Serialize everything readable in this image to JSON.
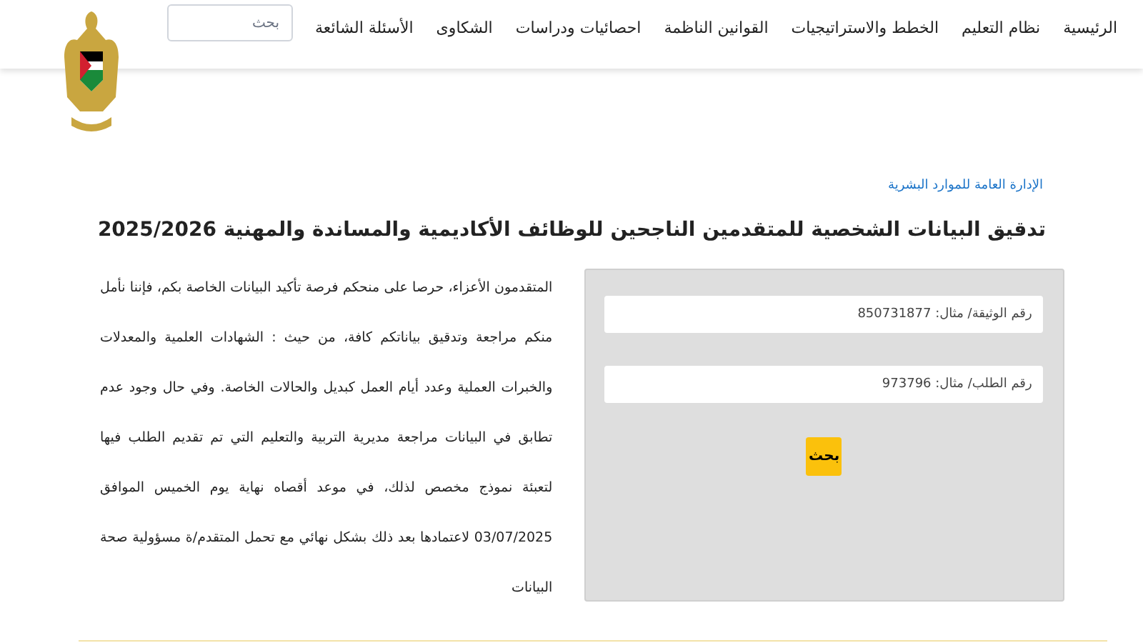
{
  "header": {
    "nav": [
      {
        "label": "الرئيسية"
      },
      {
        "label": "نظام التعليم"
      },
      {
        "label": "الخطط والاستراتيجيات"
      },
      {
        "label": "القوانين الناظمة"
      },
      {
        "label": "احصائيات ودراسات"
      },
      {
        "label": "الشكاوى"
      },
      {
        "label": "الأسئلة الشائعة"
      }
    ],
    "search": {
      "placeholder": "بحث"
    }
  },
  "breadcrumb": "الإدارة العامة للموارد البشرية",
  "title": "تدقيق البيانات الشخصية للمتقدمين الناجحين للوظائف الأكاديمية والمساندة والمهنية 2025/2026",
  "form": {
    "fields": [
      {
        "placeholder": "رقم الوثيقة/ مثال: 850731877"
      },
      {
        "placeholder": "رقم الطلب/ مثال: 973796"
      }
    ],
    "button": "بحث"
  },
  "notice": "المتقدمون الأعزاء، حرصا على منحكم فرصة تأكيد البيانات الخاصة بكم، فإننا نأمل منكم مراجعة وتدقيق بياناتكم كافة، من حيث : الشهادات العلمية والمعدلات والخبرات العملية وعدد أيام العمل كبديل والحالات الخاصة. وفي حال وجود عدم تطابق في البيانات مراجعة مديرية التربية والتعليم التي تم تقديم الطلب فيها لتعبئة نموذج مخصص لذلك، في موعد أقصاه نهاية يوم الخميس الموافق 03/07/2025 لاعتمادها بعد ذلك بشكل نهائي مع تحمل المتقدم/ة مسؤولية صحة البيانات"
}
